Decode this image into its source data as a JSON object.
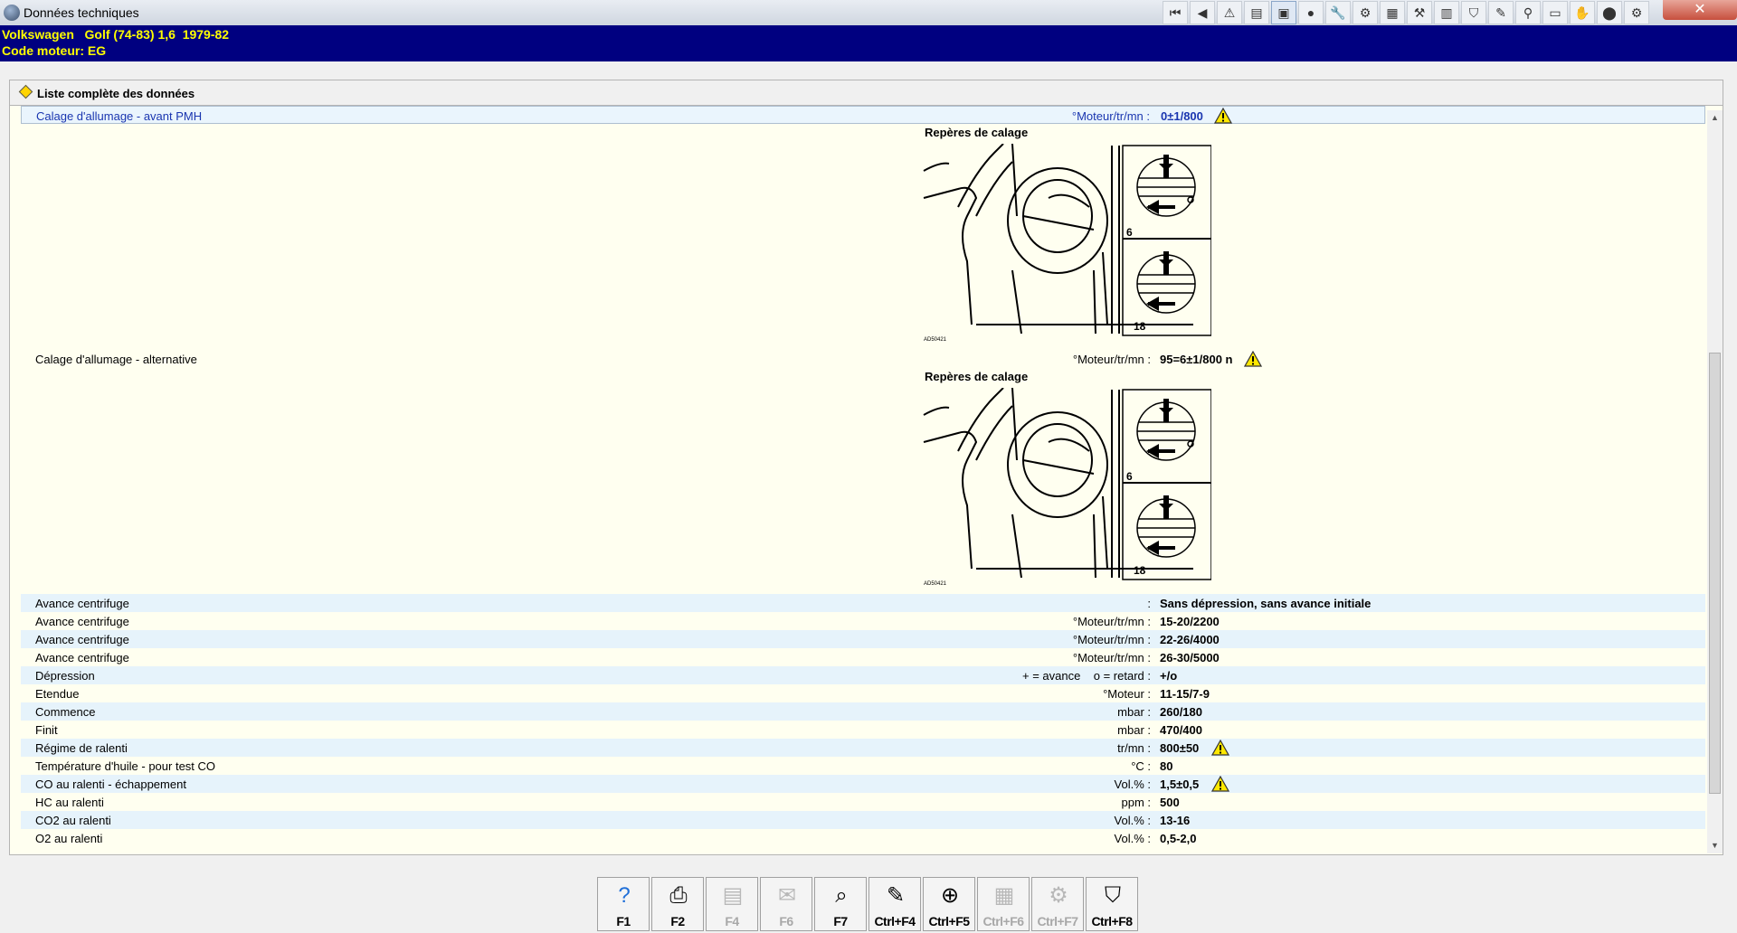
{
  "window": {
    "title": "Données techniques",
    "close_symbol": "✕"
  },
  "toolbar": {
    "icons": [
      "first-icon",
      "prev-icon",
      "warning-icon",
      "list-icon",
      "chart-icon",
      "drop-icon",
      "wrench-icon",
      "gear-icon",
      "engine-icon",
      "tools-icon",
      "battery-icon",
      "lift-icon",
      "brush-icon",
      "tool-icon",
      "car-icon",
      "glove-icon",
      "emblem-icon",
      "settings-icon"
    ],
    "glyphs": [
      "⏮",
      "◀",
      "⚠",
      "▤",
      "▣",
      "●",
      "🔧",
      "⚙",
      "▦",
      "⚒",
      "▥",
      "⛉",
      "✎",
      "⚲",
      "▭",
      "✋",
      "⬤",
      "⚙"
    ]
  },
  "vehicle": {
    "line1": "Volkswagen   Golf (74-83) 1,6  1979-82",
    "line2": "Code moteur: EG"
  },
  "section": {
    "title": "Liste complète des données"
  },
  "rows": [
    {
      "label": "Calage d'allumage - avant PMH",
      "unit": "°Moteur/tr/mn :",
      "value": "0±1/800",
      "warn": true
    },
    {
      "label": "Calage d'allumage - alternative",
      "unit": "°Moteur/tr/mn :",
      "value": "95=6±1/800 n",
      "warn": true
    },
    {
      "label": "Avance centrifuge",
      "unit": ":",
      "value": "Sans dépression, sans avance initiale",
      "warn": false
    },
    {
      "label": "Avance centrifuge",
      "unit": "°Moteur/tr/mn :",
      "value": "15-20/2200",
      "warn": false
    },
    {
      "label": "Avance centrifuge",
      "unit": "°Moteur/tr/mn :",
      "value": "22-26/4000",
      "warn": false
    },
    {
      "label": "Avance centrifuge",
      "unit": "°Moteur/tr/mn :",
      "value": "26-30/5000",
      "warn": false
    },
    {
      "label": "Dépression",
      "unit": "+ = avance    o = retard :",
      "value": "+/o",
      "warn": false
    },
    {
      "label": "Etendue",
      "unit": "°Moteur :",
      "value": "11-15/7-9",
      "warn": false
    },
    {
      "label": "Commence",
      "unit": "mbar :",
      "value": "260/180",
      "warn": false
    },
    {
      "label": "Finit",
      "unit": "mbar :",
      "value": "470/400",
      "warn": false
    },
    {
      "label": "Régime de ralenti",
      "unit": "tr/mn :",
      "value": "800±50",
      "warn": true
    },
    {
      "label": "Température d'huile - pour test CO",
      "unit": "°C :",
      "value": "80",
      "warn": false
    },
    {
      "label": "CO au ralenti - échappement",
      "unit": "Vol.% :",
      "value": "1,5±0,5",
      "warn": true
    },
    {
      "label": "HC au ralenti",
      "unit": "ppm :",
      "value": "500",
      "warn": false
    },
    {
      "label": "CO2 au ralenti",
      "unit": "Vol.% :",
      "value": "13-16",
      "warn": false
    },
    {
      "label": "O2 au ralenti",
      "unit": "Vol.% :",
      "value": "0,5-2,0",
      "warn": false
    }
  ],
  "diagrams": [
    {
      "caption": "Repères de calage",
      "mark_top": "6",
      "mark_bottom": "18",
      "code": "AD50421"
    },
    {
      "caption": "Repères de calage",
      "mark_top": "6",
      "mark_bottom": "18",
      "code": "AD50421"
    }
  ],
  "scrollbar": {
    "up": "▲",
    "down": "▼"
  },
  "function_keys": [
    {
      "key": "F1",
      "icon": "help-icon",
      "glyph": "?",
      "enabled": true
    },
    {
      "key": "F2",
      "icon": "print-icon",
      "glyph": "⎙",
      "enabled": true
    },
    {
      "key": "F4",
      "icon": "document-icon",
      "glyph": "▤",
      "enabled": false
    },
    {
      "key": "F6",
      "icon": "brief-icon",
      "glyph": "✉",
      "enabled": false
    },
    {
      "key": "F7",
      "icon": "search-icon",
      "glyph": "⌕",
      "enabled": true
    },
    {
      "key": "Ctrl+F4",
      "icon": "edit-icon",
      "glyph": "✎",
      "enabled": true
    },
    {
      "key": "Ctrl+F5",
      "icon": "add-note-icon",
      "glyph": "⊕",
      "enabled": true
    },
    {
      "key": "Ctrl+F6",
      "icon": "calculator-icon",
      "glyph": "▦",
      "enabled": false
    },
    {
      "key": "Ctrl+F7",
      "icon": "parts-icon",
      "glyph": "⚙",
      "enabled": false
    },
    {
      "key": "Ctrl+F8",
      "icon": "lift-icon",
      "glyph": "⛉",
      "enabled": true
    }
  ]
}
